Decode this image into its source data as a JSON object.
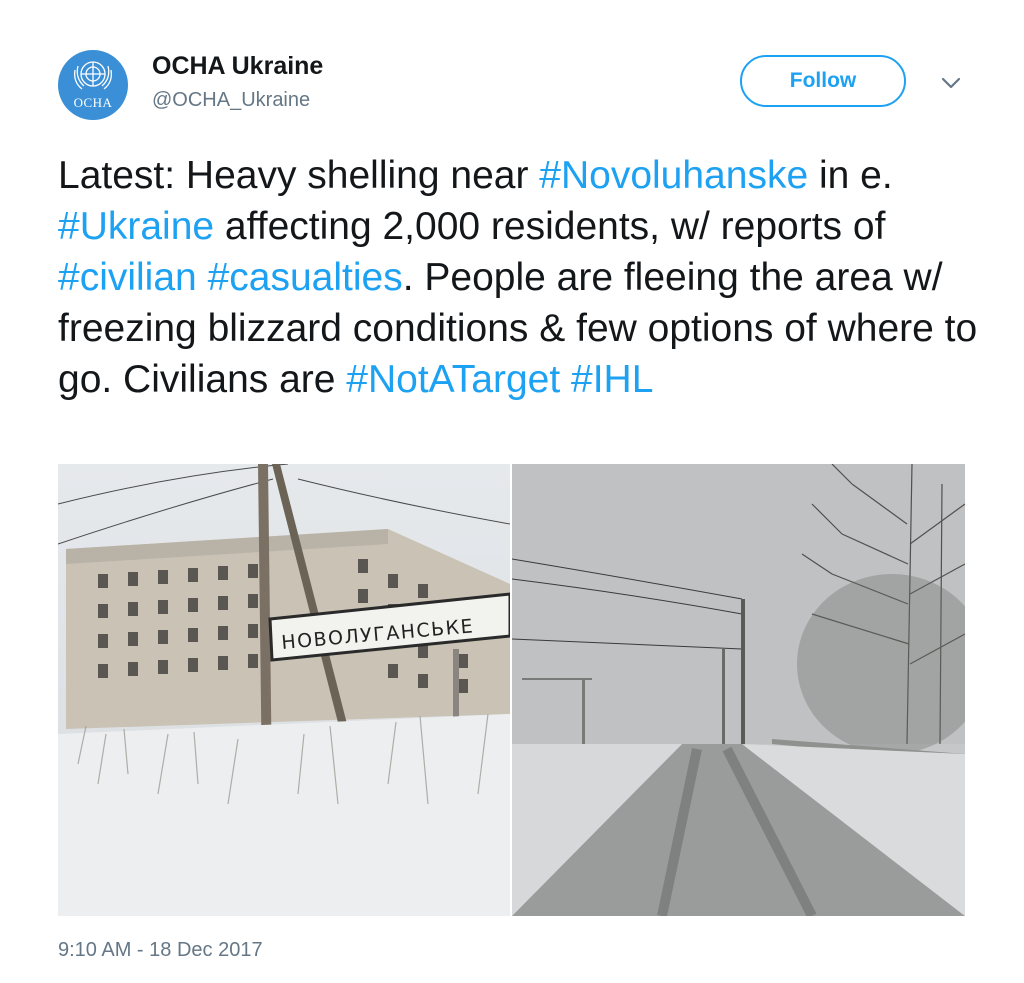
{
  "account": {
    "display_name": "OCHA Ukraine",
    "handle": "@OCHA_Ukraine",
    "avatar_text": "OCHA",
    "follow_label": "Follow"
  },
  "tweet": {
    "parts": [
      {
        "text": "Latest: Heavy shelling near ",
        "link": false
      },
      {
        "text": "#Novoluhanske",
        "link": true
      },
      {
        "text": " in e. ",
        "link": false
      },
      {
        "text": "#Ukraine",
        "link": true
      },
      {
        "text": " affecting 2,000 residents, w/ reports of ",
        "link": false
      },
      {
        "text": "#civilian",
        "link": true
      },
      {
        "text": " ",
        "link": false
      },
      {
        "text": "#casualties",
        "link": true
      },
      {
        "text": ". People are fleeing the area w/ freezing blizzard conditions & few options of where to go. Civilians are ",
        "link": false
      },
      {
        "text": "#NotATarget",
        "link": true
      },
      {
        "text": " ",
        "link": false
      },
      {
        "text": "#IHL",
        "link": true
      }
    ],
    "timestamp": "9:10 AM - 18 Dec 2017"
  },
  "media": {
    "sign_text": "НОВОЛУГАНСЬКЕ"
  },
  "colors": {
    "link": "#1da1f2",
    "text": "#14171a",
    "muted": "#657786",
    "avatar_bg": "#3a8fd6"
  },
  "icons": {
    "avatar_emblem": "un-emblem-icon",
    "caret": "chevron-down-icon"
  }
}
